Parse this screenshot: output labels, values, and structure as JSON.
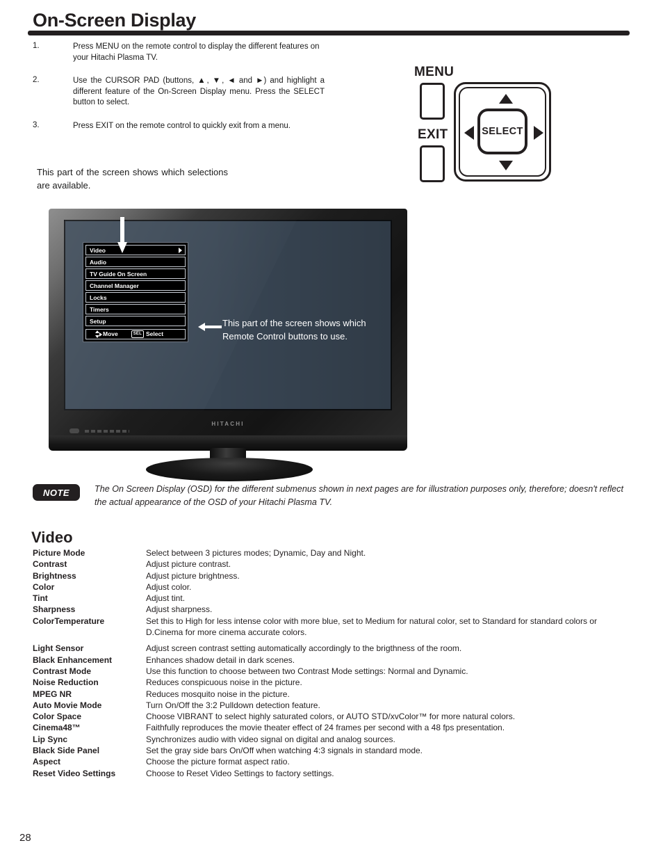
{
  "page": {
    "title": "On-Screen Display",
    "number": "28"
  },
  "steps": [
    {
      "num": "1.",
      "text": "Press MENU on the remote control to display the different features on your Hitachi Plasma TV."
    },
    {
      "num": "2.",
      "text": "Use the CURSOR PAD (buttons, ▲, ▼, ◄ and ►) and highlight a different feature of the On-Screen Display menu. Press the SELECT button to select."
    },
    {
      "num": "3.",
      "text": "Press EXIT on the remote control to quickly exit from a menu."
    }
  ],
  "callouts": {
    "left": "This part of the screen shows which selections are available.",
    "screen": "This part of the screen shows which Remote Control buttons to use."
  },
  "remote": {
    "menu_label": "MENU",
    "exit_label": "EXIT",
    "select_label": "SELECT"
  },
  "tv": {
    "brand": "HITACHI"
  },
  "osd": {
    "items": [
      {
        "label": "Video",
        "has_submenu_arrow": true
      },
      {
        "label": "Audio",
        "has_submenu_arrow": false
      },
      {
        "label": "TV Guide On Screen",
        "has_submenu_arrow": false
      },
      {
        "label": "Channel Manager",
        "has_submenu_arrow": false
      },
      {
        "label": "Locks",
        "has_submenu_arrow": false
      },
      {
        "label": "Timers",
        "has_submenu_arrow": false
      },
      {
        "label": "Setup",
        "has_submenu_arrow": false
      }
    ],
    "footer": {
      "move_label": "Move",
      "sel_key": "SEL",
      "select_label": "Select"
    }
  },
  "note": {
    "badge": "NOTE",
    "text": "The On Screen Display (OSD) for the different submenus shown in next pages are for illustration purposes only, therefore; doesn't reflect the actual appearance of the OSD of your Hitachi Plasma TV."
  },
  "video_section": {
    "heading": "Video",
    "rows": [
      {
        "term": "Picture Mode",
        "definition": "Select between 3 pictures modes; Dynamic, Day and Night."
      },
      {
        "term": "Contrast",
        "definition": "Adjust picture contrast."
      },
      {
        "term": "Brightness",
        "definition": "Adjust picture brightness."
      },
      {
        "term": "Color",
        "definition": "Adjust color."
      },
      {
        "term": "Tint",
        "definition": "Adjust tint."
      },
      {
        "term": "Sharpness",
        "definition": "Adjust sharpness."
      },
      {
        "term": "ColorTemperature",
        "definition": "Set this to High for less intense color with more blue, set to Medium for natural color, set to Standard for standard colors or D.Cinema for more cinema accurate colors."
      },
      {
        "term": "Light Sensor",
        "definition": "Adjust screen contrast setting automatically accordingly to the brigthness of the room."
      },
      {
        "term": "Black Enhancement",
        "definition": "Enhances shadow detail in dark scenes."
      },
      {
        "term": "Contrast Mode",
        "definition": "Use this function to choose between two Contrast Mode settings: Normal and Dynamic."
      },
      {
        "term": "Noise Reduction",
        "definition": "Reduces conspicuous noise in the picture."
      },
      {
        "term": "MPEG NR",
        "definition": "Reduces mosquito noise in the picture."
      },
      {
        "term": "Auto Movie Mode",
        "definition": "Turn On/Off the 3:2 Pulldown detection feature."
      },
      {
        "term": "Color Space",
        "definition": "Choose VIBRANT to select highly saturated colors, or AUTO STD/xvColor™ for more natural colors."
      },
      {
        "term": "Cinema48™",
        "definition": "Faithfully reproduces the movie theater effect of 24 frames per second with a 48 fps presentation."
      },
      {
        "term": "Lip Sync",
        "definition": "Synchronizes audio with video signal on digital and analog sources."
      },
      {
        "term": "Black Side Panel",
        "definition": "Set the gray side bars On/Off when watching 4:3 signals in standard mode."
      },
      {
        "term": "Aspect",
        "definition": "Choose the picture format aspect ratio."
      },
      {
        "term": "Reset Video Settings",
        "definition": "Choose to Reset Video Settings to factory settings."
      }
    ]
  }
}
